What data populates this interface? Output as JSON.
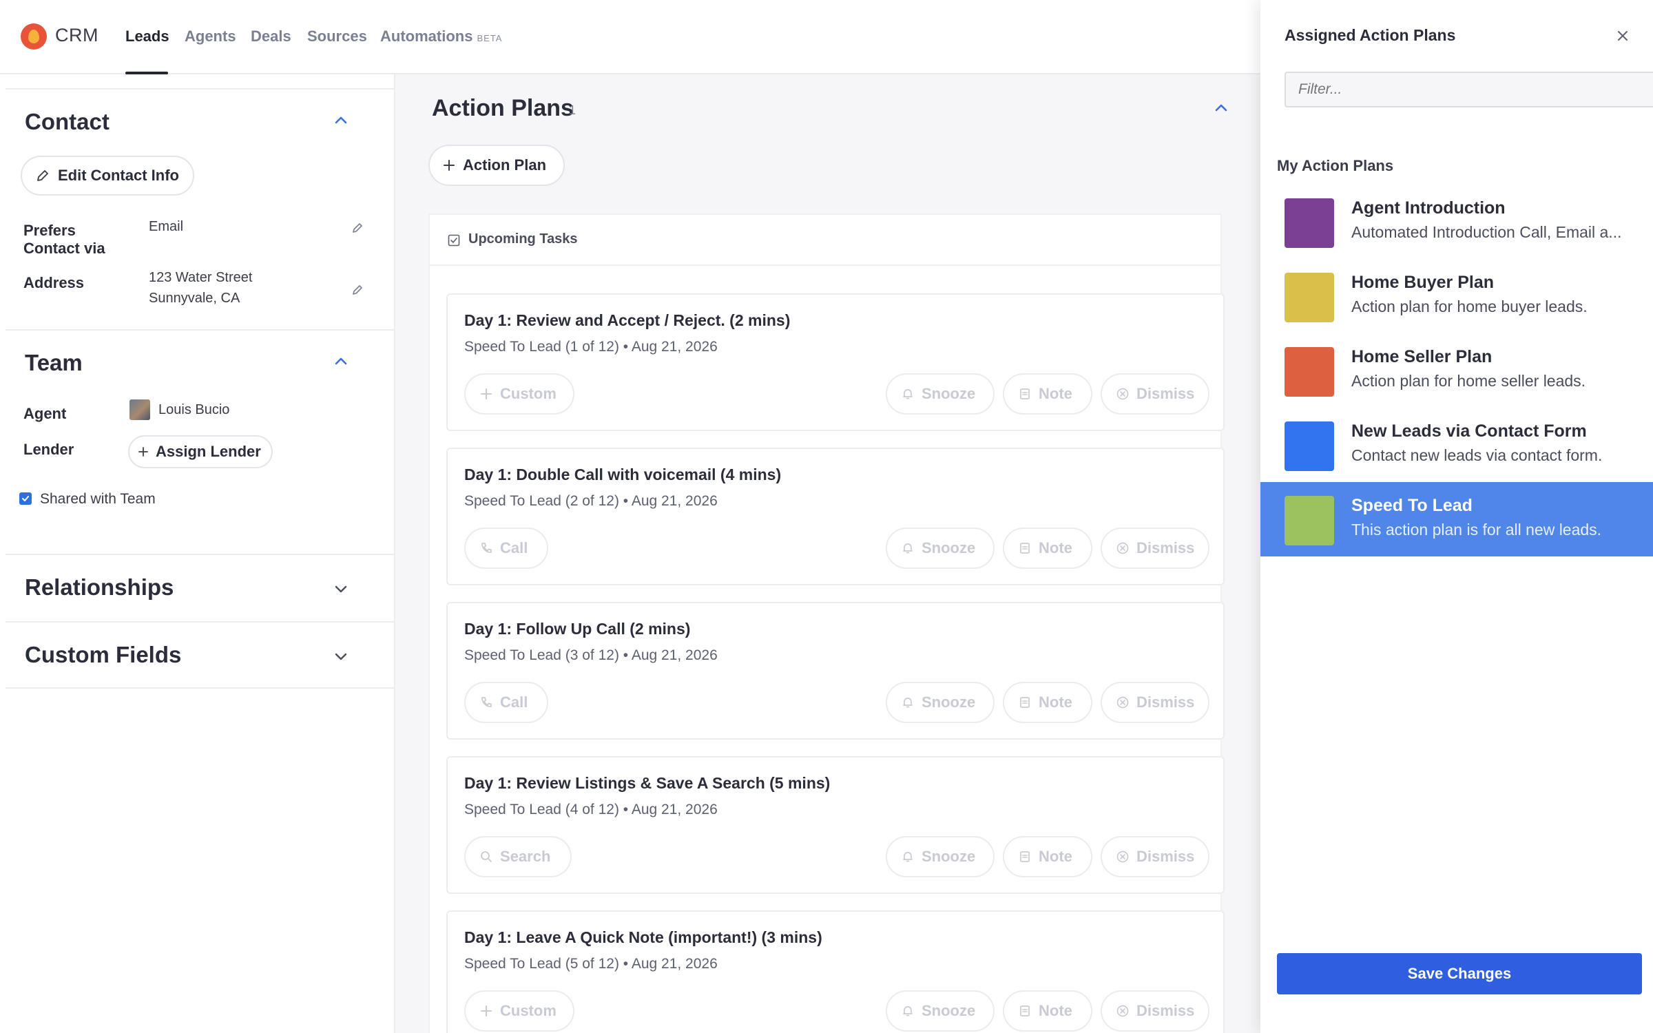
{
  "app": {
    "name": "CRM"
  },
  "nav": {
    "tabs": [
      {
        "label": "Leads"
      },
      {
        "label": "Agents"
      },
      {
        "label": "Deals"
      },
      {
        "label": "Sources"
      },
      {
        "label": "Automations"
      }
    ],
    "beta": "BETA"
  },
  "contact": {
    "title": "Contact",
    "edit_label": "Edit Contact Info",
    "prefers_label": "Prefers Contact via",
    "prefers_value": "Email",
    "address_label": "Address",
    "address_line1": "123 Water Street",
    "address_line2": "Sunnyvale, CA"
  },
  "team": {
    "title": "Team",
    "agent_label": "Agent",
    "agent_name": "Louis Bucio",
    "lender_label": "Lender",
    "assign_lender_label": "Assign Lender",
    "shared_label": "Shared with Team"
  },
  "relationships": {
    "title": "Relationships"
  },
  "custom_fields": {
    "title": "Custom Fields"
  },
  "action_plans": {
    "title": "Action Plans",
    "count": "1",
    "add_label": "Action Plan",
    "upcoming_label": "Upcoming Tasks",
    "tasks": [
      {
        "title": "Day 1: Review and Accept / Reject. (2 mins)",
        "sub": "Speed To Lead (1 of 12) • Aug 21, 2026",
        "action": "Custom",
        "action_icon": "plus-icon"
      },
      {
        "title": "Day 1: Double Call with voicemail (4 mins)",
        "sub": "Speed To Lead (2 of 12) • Aug 21, 2026",
        "action": "Call",
        "action_icon": "phone-icon"
      },
      {
        "title": "Day 1: Follow Up Call (2 mins)",
        "sub": "Speed To Lead (3 of 12) • Aug 21, 2026",
        "action": "Call",
        "action_icon": "phone-icon"
      },
      {
        "title": "Day 1: Review Listings & Save A Search (5 mins)",
        "sub": "Speed To Lead (4 of 12) • Aug 21, 2026",
        "action": "Search",
        "action_icon": "search-icon"
      },
      {
        "title": "Day 1: Leave A Quick Note (important!) (3 mins)",
        "sub": "Speed To Lead (5 of 12) • Aug 21, 2026",
        "action": "Custom",
        "action_icon": "plus-icon"
      }
    ],
    "snooze_label": "Snooze",
    "note_label": "Note",
    "dismiss_label": "Dismiss"
  },
  "drawer": {
    "title": "Assigned Action Plans",
    "filter_placeholder": "Filter...",
    "section_label": "My Action Plans",
    "plans": [
      {
        "name": "Agent Introduction",
        "desc": "Automated Introduction Call, Email a...",
        "color": "#7b3f94"
      },
      {
        "name": "Home Buyer Plan",
        "desc": "Action plan for home buyer leads.",
        "color": "#d9c04a"
      },
      {
        "name": "Home Seller Plan",
        "desc": "Action plan for home seller leads.",
        "color": "#dd6140"
      },
      {
        "name": "New Leads via Contact Form",
        "desc": "Contact new leads via contact form.",
        "color": "#3273f0"
      },
      {
        "name": "Speed To Lead",
        "desc": "This action plan is for all new leads.",
        "color": "#9bc25f"
      }
    ],
    "selected_index": 4,
    "save_label": "Save Changes"
  }
}
